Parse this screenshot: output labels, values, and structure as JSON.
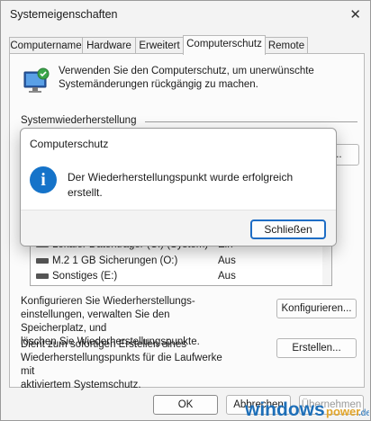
{
  "window": {
    "title": "Systemeigenschaften",
    "close_glyph": "✕"
  },
  "tabs": [
    {
      "label": "Computername"
    },
    {
      "label": "Hardware"
    },
    {
      "label": "Erweitert"
    },
    {
      "label": "Computerschutz",
      "active": true
    },
    {
      "label": "Remote"
    }
  ],
  "intro": {
    "icon": "system-protection-icon",
    "line1": "Verwenden Sie den Computerschutz, um unerwünschte",
    "line2": "Systemänderungen rückgängig zu machen."
  },
  "restore_section": {
    "label": "Systemwiederherstellung",
    "button_partial": "..."
  },
  "drives": [
    {
      "name": "Lokaler Datenträger (C:) (System)",
      "status": "Ein"
    },
    {
      "name": "M.2 1 GB Sicherungen (O:)",
      "status": "Aus"
    },
    {
      "name": "Sonstiges (E:)",
      "status": "Aus"
    }
  ],
  "configure": {
    "line1": "Konfigurieren Sie Wiederherstellungs-",
    "line2": "einstellungen, verwalten Sie den Speicherplatz, und",
    "line3": "löschen Sie Wiederherstellungspunkte.",
    "button": "Konfigurieren..."
  },
  "create": {
    "line1": "Dient zum sofortigen Erstellen eines",
    "line2": "Wiederherstellungspunkts für die Laufwerke mit",
    "line3": "aktiviertem Systemschutz.",
    "button": "Erstellen..."
  },
  "footer": {
    "ok": "OK",
    "cancel": "Abbrechen",
    "apply": "Übernehmen"
  },
  "dialog": {
    "title": "Computerschutz",
    "icon": "info-icon",
    "message_line1": "Der Wiederherstellungspunkt wurde erfolgreich",
    "message_line2": "erstellt.",
    "close_button": "Schließen",
    "accent": "#1573c9"
  },
  "watermark": {
    "text1": "windows",
    "text2": "power",
    "text3": ".de"
  }
}
